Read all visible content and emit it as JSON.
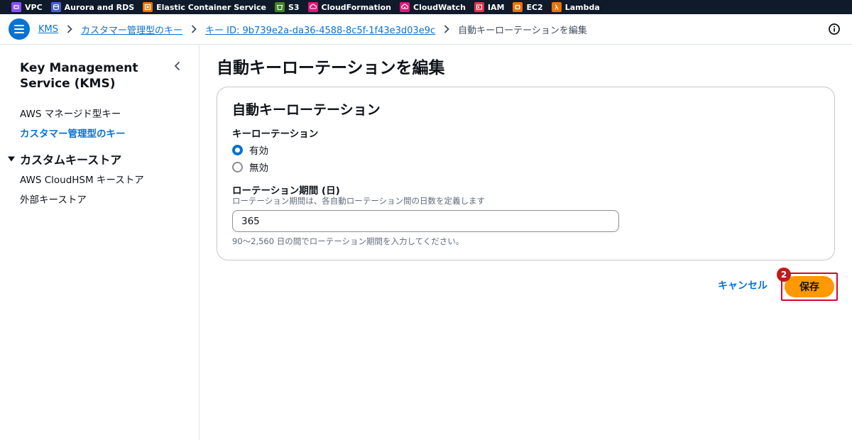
{
  "service_bar": {
    "items": [
      {
        "label": "VPC",
        "icon": "vpc-icon",
        "color": "#8c4fff"
      },
      {
        "label": "Aurora and RDS",
        "icon": "rds-icon",
        "color": "#4b61d1"
      },
      {
        "label": "Elastic Container Service",
        "icon": "ecs-icon",
        "color": "#ed7100"
      },
      {
        "label": "S3",
        "icon": "s3-icon",
        "color": "#3f8624"
      },
      {
        "label": "CloudFormation",
        "icon": "cloudformation-icon",
        "color": "#e7157b"
      },
      {
        "label": "CloudWatch",
        "icon": "cloudwatch-icon",
        "color": "#e7157b"
      },
      {
        "label": "IAM",
        "icon": "iam-icon",
        "color": "#dd344c"
      },
      {
        "label": "EC2",
        "icon": "ec2-icon",
        "color": "#ed7100"
      },
      {
        "label": "Lambda",
        "icon": "lambda-icon",
        "color": "#ed7100"
      }
    ]
  },
  "breadcrumb": {
    "items": [
      {
        "label": "KMS"
      },
      {
        "label": "カスタマー管理型のキー"
      },
      {
        "label": "キー ID: 9b739e2a-da36-4588-8c5f-1f43e3d03e9c"
      }
    ],
    "current": "自動キーローテーションを編集"
  },
  "sidebar": {
    "title": "Key Management Service (KMS)",
    "items": [
      {
        "label": "AWS マネージド型キー",
        "active": false
      },
      {
        "label": "カスタマー管理型のキー",
        "active": true
      }
    ],
    "section": {
      "label": "カスタムキーストア",
      "items": [
        {
          "label": "AWS CloudHSM キーストア"
        },
        {
          "label": "外部キーストア"
        }
      ]
    }
  },
  "main": {
    "page_title": "自動キーローテーションを編集",
    "panel": {
      "title": "自動キーローテーション",
      "rotation_label": "キーローテーション",
      "options": [
        {
          "label": "有効",
          "checked": true
        },
        {
          "label": "無効",
          "checked": false
        }
      ],
      "period_label": "ローテーション期間 (日)",
      "period_description": "ローテーション期間は、各自動ローテーション間の日数を定義します",
      "period_value": "365",
      "period_hint": "90～2,560 日の間でローテーション期間を入力してください。"
    },
    "actions": {
      "cancel_label": "キャンセル",
      "save_label": "保存",
      "step_badge": "2"
    }
  },
  "colors": {
    "accent": "#0972d3",
    "primary_button": "#ff9900",
    "highlight": "#d1092e"
  }
}
